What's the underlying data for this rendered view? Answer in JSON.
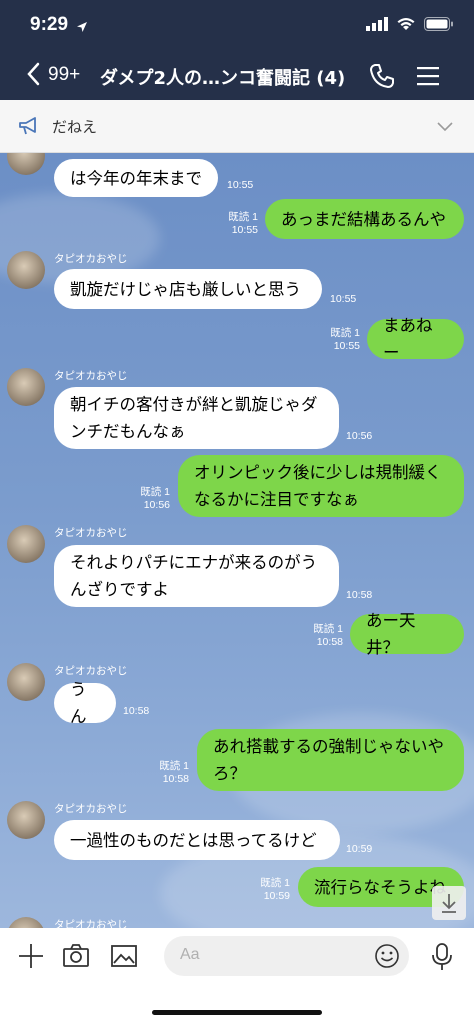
{
  "status_bar": {
    "time": "9:29"
  },
  "header": {
    "back_count": "99+",
    "title": "ダメプ2人の…ンコ奮闘記 (4)"
  },
  "announcement": {
    "text": "だねえ"
  },
  "sender_name": "タピオカおやじ",
  "messages": [
    {
      "id": "m1",
      "type": "in",
      "text": "は今年の年末まで",
      "time": "10:55"
    },
    {
      "id": "m2",
      "type": "out",
      "text": "あっまだ結構あるんや",
      "read": "既読 1",
      "time": "10:55"
    },
    {
      "id": "m3",
      "type": "in",
      "text": "凱旋だけじゃ店も厳しいと思う",
      "time": "10:55"
    },
    {
      "id": "m4",
      "type": "out",
      "text": "まあねー",
      "read": "既読 1",
      "time": "10:55"
    },
    {
      "id": "m5",
      "type": "in",
      "lines": [
        "朝イチの客付きが絆と凱旋じゃダ",
        "ンチだもんなぁ"
      ],
      "time": "10:56"
    },
    {
      "id": "m6",
      "type": "out",
      "lines": [
        "オリンピック後に少しは規制緩く",
        "なるかに注目ですなぁ"
      ],
      "read": "既読 1",
      "time": "10:56"
    },
    {
      "id": "m7",
      "type": "in",
      "lines": [
        "それよりパチにエナが来るのがう",
        "んざりですよ"
      ],
      "time": "10:58"
    },
    {
      "id": "m8",
      "type": "out",
      "text": "あー天井？",
      "read": "既読 1",
      "time": "10:58"
    },
    {
      "id": "m9",
      "type": "in",
      "text": "うん",
      "time": "10:58"
    },
    {
      "id": "m10",
      "type": "out",
      "lines": [
        "あれ搭載するの強制じゃないや",
        "ろ？"
      ],
      "read": "既読 1",
      "time": "10:58"
    },
    {
      "id": "m11",
      "type": "in",
      "text": "一過性のものだとは思ってるけど",
      "time": "10:59"
    },
    {
      "id": "m12",
      "type": "out",
      "text": "流行らなそうよね",
      "read": "既読 1",
      "time": "10:59"
    }
  ],
  "input": {
    "placeholder": "Aa"
  },
  "icons": {
    "back": "chevron-left-icon",
    "call": "phone-icon",
    "menu": "hamburger-menu-icon",
    "announcement": "megaphone-icon",
    "expand": "chevron-down-icon",
    "add": "plus-icon",
    "camera": "camera-icon",
    "image": "image-icon",
    "emoji": "emoji-icon",
    "mic": "microphone-icon",
    "scroll": "arrow-down-icon"
  },
  "colors": {
    "header_bg": "#253049",
    "outgoing_bubble": "#7ed64a",
    "incoming_bubble": "#ffffff",
    "chat_bg": "#7b9ccd"
  }
}
